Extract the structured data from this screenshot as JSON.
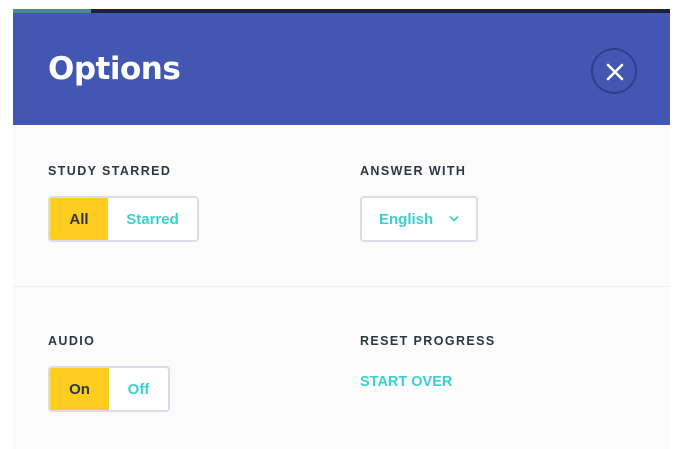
{
  "modal": {
    "title": "Options",
    "close_icon": "close-icon"
  },
  "study_starred": {
    "label": "STUDY STARRED",
    "options": [
      "All",
      "Starred"
    ],
    "selected": "All"
  },
  "answer_with": {
    "label": "ANSWER WITH",
    "value": "English",
    "icon": "chevron-down-icon"
  },
  "audio": {
    "label": "AUDIO",
    "options": [
      "On",
      "Off"
    ],
    "selected": "On"
  },
  "reset_progress": {
    "label": "RESET PROGRESS",
    "action": "START OVER"
  },
  "colors": {
    "header": "#4257b2",
    "active": "#ffcd1f",
    "accent_text": "#3ccfcf",
    "label_text": "#303545"
  }
}
